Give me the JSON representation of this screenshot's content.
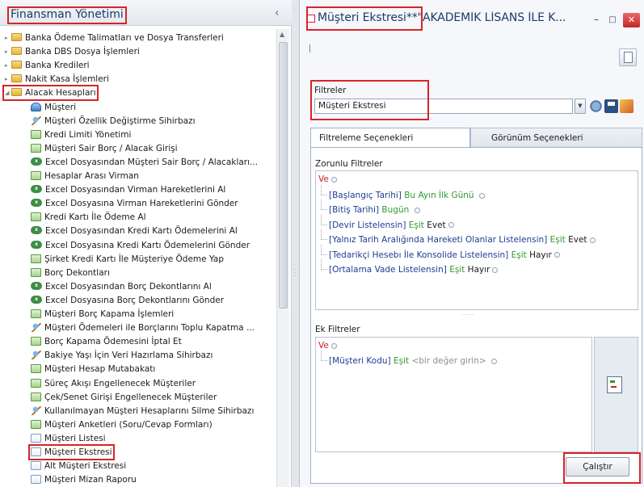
{
  "left_panel": {
    "title": "Finansman Yönetimi",
    "collapse_glyph": "‹",
    "tree": [
      {
        "label": "Banka Ödeme Talimatları ve Dosya Transferleri",
        "icon": "folder-icon",
        "level": 0,
        "expander": "▸"
      },
      {
        "label": "Banka DBS Dosya İşlemleri",
        "icon": "folder-icon",
        "level": 0,
        "expander": "▸"
      },
      {
        "label": "Banka Kredileri",
        "icon": "folder-icon",
        "level": 0,
        "expander": "▸"
      },
      {
        "label": "Nakit Kasa İşlemleri",
        "icon": "folder-icon",
        "level": 0,
        "expander": "▸"
      },
      {
        "label": "Alacak Hesapları",
        "icon": "folder-icon",
        "level": 0,
        "expander": "◢",
        "highlighted": true
      },
      {
        "label": "Müşteri",
        "icon": "client-icon",
        "level": 1
      },
      {
        "label": "Müşteri Özellik Değiştirme Sihirbazı",
        "icon": "wizard-icon",
        "level": 1
      },
      {
        "label": "Kredi Limiti Yönetimi",
        "icon": "form-icon",
        "level": 1
      },
      {
        "label": "Müşteri Sair Borç / Alacak Girişi",
        "icon": "form-icon",
        "level": 1
      },
      {
        "label": "Excel Dosyasından Müşteri Sair Borç / Alacakları...",
        "icon": "excel-icon",
        "level": 1
      },
      {
        "label": "Hesaplar Arası Virman",
        "icon": "form-icon",
        "level": 1
      },
      {
        "label": "Excel Dosyasından Virman Hareketlerini Al",
        "icon": "excel-icon",
        "level": 1
      },
      {
        "label": "Excel Dosyasına Virman Hareketlerini Gönder",
        "icon": "excel-icon",
        "level": 1
      },
      {
        "label": "Kredi Kartı İle Ödeme Al",
        "icon": "form-icon",
        "level": 1
      },
      {
        "label": "Excel Dosyasından Kredi Kartı Ödemelerini Al",
        "icon": "excel-icon",
        "level": 1
      },
      {
        "label": "Excel Dosyasına Kredi Kartı Ödemelerini Gönder",
        "icon": "excel-icon",
        "level": 1
      },
      {
        "label": "Şirket Kredi Kartı İle Müşteriye Ödeme Yap",
        "icon": "form-icon",
        "level": 1
      },
      {
        "label": "Borç Dekontları",
        "icon": "form-icon",
        "level": 1
      },
      {
        "label": "Excel Dosyasından Borç Dekontlarını Al",
        "icon": "excel-icon",
        "level": 1
      },
      {
        "label": "Excel Dosyasına Borç Dekontlarını Gönder",
        "icon": "excel-icon",
        "level": 1
      },
      {
        "label": "Müşteri Borç Kapama İşlemleri",
        "icon": "form-icon",
        "level": 1
      },
      {
        "label": "Müşteri Ödemeleri ile Borçlarını Toplu Kapatma ...",
        "icon": "wizard-icon",
        "level": 1
      },
      {
        "label": "Borç Kapama Ödemesini İptal Et",
        "icon": "form-icon",
        "level": 1
      },
      {
        "label": "Bakiye Yaşı İçin Veri Hazırlama Sihirbazı",
        "icon": "wizard-icon",
        "level": 1
      },
      {
        "label": "Müşteri Hesap Mutabakatı",
        "icon": "form-icon",
        "level": 1
      },
      {
        "label": "Süreç Akışı Engellenecek Müşteriler",
        "icon": "form-icon",
        "level": 1
      },
      {
        "label": "Çek/Senet Girişi Engellenecek Müşteriler",
        "icon": "form-icon",
        "level": 1
      },
      {
        "label": "Kullanılmayan Müşteri Hesaplarını Silme Sihirbazı",
        "icon": "wizard-icon",
        "level": 1
      },
      {
        "label": "Müşteri Anketleri (Soru/Cevap Formları)",
        "icon": "form-icon",
        "level": 1
      },
      {
        "label": "Müşteri Listesi",
        "icon": "page-icon",
        "level": 1
      },
      {
        "label": "Müşteri Ekstresi",
        "icon": "page-icon",
        "level": 1,
        "highlighted": true
      },
      {
        "label": "Alt Müşteri Ekstresi",
        "icon": "page-icon",
        "level": 1
      },
      {
        "label": "Müşteri Mizan Raporu",
        "icon": "page-icon",
        "level": 1
      }
    ]
  },
  "window": {
    "title": "Müşteri Ekstresi**\"AKADEMİK LİSANS İLE K...",
    "minimize": "–",
    "maximize": "□",
    "close": "✕"
  },
  "filters": {
    "label": "Filtreler",
    "selected": "Müşteri Ekstresi",
    "combo_arrow": "▼"
  },
  "tabs": [
    {
      "label": "Filtreleme Seçenekleri",
      "active": true
    },
    {
      "label": "Görünüm Seçenekleri",
      "active": false
    }
  ],
  "mandatory": {
    "label": "Zorunlu Filtreler",
    "operator": "Ve",
    "conditions": [
      {
        "field": "[Başlangıç Tarihi]",
        "comparator": "Bu Ayın İlk Günü",
        "value": ""
      },
      {
        "field": "[Bitiş Tarihi]",
        "comparator": "Bugün",
        "value": ""
      },
      {
        "field": "[Devir Listelensin]",
        "comparator": "Eşit",
        "value": "Evet"
      },
      {
        "field": "[Yalnız Tarih Aralığında Hareketi Olanlar Listelensin]",
        "comparator": "Eşit",
        "value": "Evet"
      },
      {
        "field": "[Tedarikçi Hesebı İle Konsolide Listelensin]",
        "comparator": "Eşit",
        "value": "Hayır"
      },
      {
        "field": "[Ortalama Vade Listelensin]",
        "comparator": "Eşit",
        "value": "Hayır"
      }
    ]
  },
  "extra": {
    "label": "Ek Filtreler",
    "operator": "Ve",
    "condition": {
      "field": "[Müşteri Kodu]",
      "comparator": "Eşit",
      "value": "<bir değer girin>"
    }
  },
  "splitter_glyph": "·····",
  "run_button": "Çalıştır"
}
